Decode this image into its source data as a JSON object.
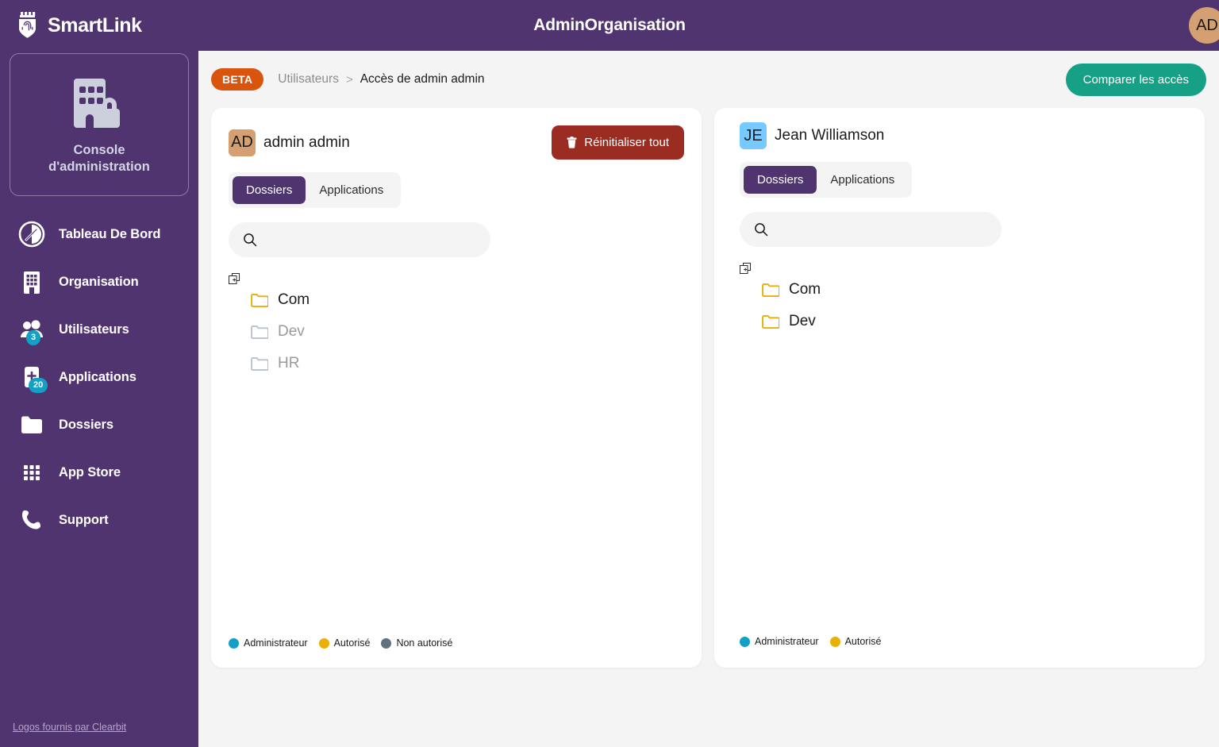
{
  "topbar": {
    "brand": "SmartLink",
    "brand_logo_icon": "shield-fingerprint-icon",
    "title": "AdminOrganisation",
    "avatar_initials": "AD",
    "avatar_color": "#d5a071"
  },
  "sidebar": {
    "console": {
      "icon": "building-lock-icon",
      "line1": "Console",
      "line2": "d'administration"
    },
    "items": [
      {
        "label": "Tableau De Bord",
        "icon": "gauge-icon",
        "badge": null
      },
      {
        "label": "Organisation",
        "icon": "building-icon",
        "badge": null
      },
      {
        "label": "Utilisateurs",
        "icon": "users-icon",
        "badge": "3"
      },
      {
        "label": "Applications",
        "icon": "app-plus-icon",
        "badge": "20"
      },
      {
        "label": "Dossiers",
        "icon": "folder-icon",
        "badge": null
      },
      {
        "label": "App Store",
        "icon": "grid-icon",
        "badge": null
      },
      {
        "label": "Support",
        "icon": "phone-icon",
        "badge": null
      }
    ],
    "footer_link": "Logos fournis par Clearbit"
  },
  "breadcrumb": {
    "beta_badge": "BETA",
    "parent": "Utilisateurs",
    "separator": ">",
    "current": "Accès de admin admin"
  },
  "actions": {
    "compare_label": "Comparer les accès",
    "compare_color": "#16a085"
  },
  "left_panel": {
    "avatar_initials": "AD",
    "avatar_color": "#d5a071",
    "user_name": "admin admin",
    "reset_label": "Réinitialiser tout",
    "reset_icon": "trash-icon",
    "reset_color": "#9b2c22",
    "tabs": [
      {
        "label": "Dossiers",
        "active": true
      },
      {
        "label": "Applications",
        "active": false
      }
    ],
    "search": {
      "value": "",
      "placeholder": "",
      "icon": "search-icon"
    },
    "expand_all_icon": "expand-all-icon",
    "tree": [
      {
        "label": "Com",
        "state": "on"
      },
      {
        "label": "Dev",
        "state": "off"
      },
      {
        "label": "HR",
        "state": "off"
      }
    ],
    "legend": [
      {
        "label": "Administrateur",
        "color": "#14a0c4"
      },
      {
        "label": "Autorisé",
        "color": "#e8b008"
      },
      {
        "label": "Non autorisé",
        "color": "#62707f"
      }
    ]
  },
  "right_panel": {
    "avatar_initials": "JE",
    "avatar_color": "#76caff",
    "user_name": "Jean Williamson",
    "tabs": [
      {
        "label": "Dossiers",
        "active": true
      },
      {
        "label": "Applications",
        "active": false
      }
    ],
    "search": {
      "value": "",
      "placeholder": "",
      "icon": "search-icon"
    },
    "expand_all_icon": "expand-all-icon",
    "tree": [
      {
        "label": "Com",
        "state": "on"
      },
      {
        "label": "Dev",
        "state": "on"
      }
    ],
    "legend": [
      {
        "label": "Administrateur",
        "color": "#14a0c4"
      },
      {
        "label": "Autorisé",
        "color": "#e8b008"
      }
    ]
  }
}
